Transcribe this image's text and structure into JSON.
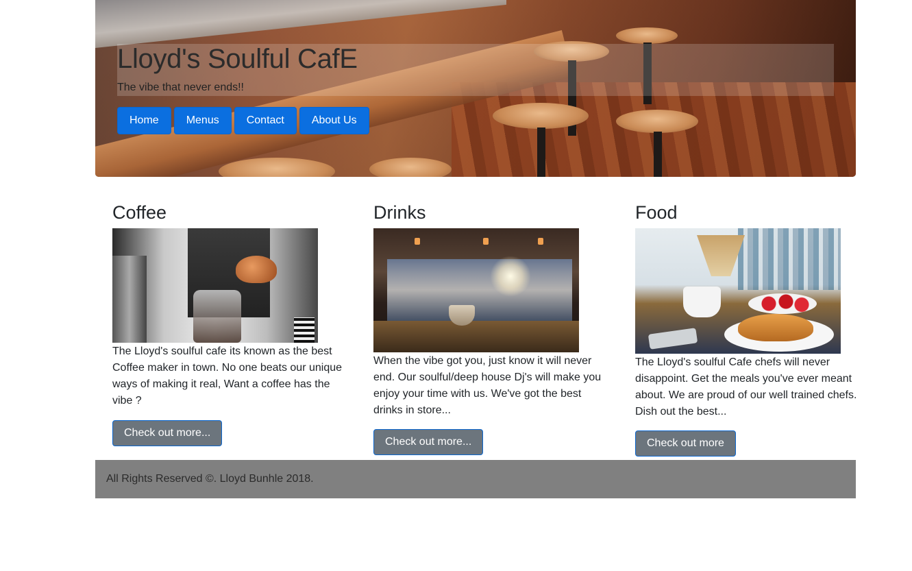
{
  "hero": {
    "title": "Lloyd's Soulful CafE",
    "tagline": "The vibe that never ends!!"
  },
  "nav": {
    "home": "Home",
    "menus": "Menus",
    "contact": "Contact",
    "about": "About Us"
  },
  "columns": [
    {
      "heading": "Coffee",
      "body": "The Lloyd's soulful cafe its known as the best Coffee maker in town. No one beats our unique ways of making it real, Want a coffee has the vibe ?",
      "button": "Check out more..."
    },
    {
      "heading": "Drinks",
      "body": "When the vibe got you, just know it will never end. Our soulful/deep house Dj's will make you enjoy your time with us. We've got the best drinks in store...",
      "button": "Check out more..."
    },
    {
      "heading": "Food",
      "body": "The Lloyd's soulful Cafe chefs will never disappoint. Get the meals you've ever meant about. We are proud of our well trained chefs. Dish out the best...",
      "button": "Check out more"
    }
  ],
  "footer": {
    "text": "All Rights Reserved ©. Lloyd Bunhle 2018."
  },
  "colors": {
    "nav_button": "#0b6fe0",
    "more_button": "#6c757d",
    "footer_bg": "#808080"
  }
}
